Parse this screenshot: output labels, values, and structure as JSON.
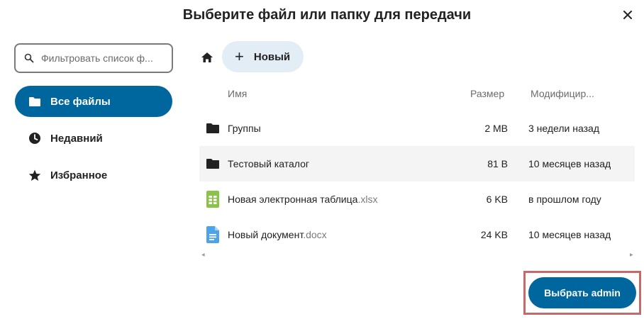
{
  "dialog": {
    "title": "Выберите файл или папку для передачи",
    "close_icon": "close-icon"
  },
  "sidebar": {
    "search_placeholder": "Фильтровать список ф...",
    "items": [
      {
        "label": "Все файлы",
        "icon": "folder-icon",
        "active": true
      },
      {
        "label": "Недавний",
        "icon": "clock-icon",
        "active": false
      },
      {
        "label": "Избранное",
        "icon": "star-icon",
        "active": false
      }
    ]
  },
  "toolbar": {
    "home_icon": "home-icon",
    "new_label": "Новый"
  },
  "table": {
    "headers": {
      "name": "Имя",
      "size": "Размер",
      "modified": "Модифицир..."
    },
    "rows": [
      {
        "name": "Группы",
        "ext": "",
        "size": "2 MB",
        "modified": "3 недели назад",
        "icon": "folder-icon"
      },
      {
        "name": "Тестовый каталог",
        "ext": "",
        "size": "81 B",
        "modified": "10 месяцев назад",
        "icon": "folder-icon"
      },
      {
        "name": "Новая электронная таблица",
        "ext": ".xlsx",
        "size": "6 KB",
        "modified": "в прошлом году",
        "icon": "spreadsheet-icon"
      },
      {
        "name": "Новый документ",
        "ext": ".docx",
        "size": "24 KB",
        "modified": "10 месяцев назад",
        "icon": "document-icon"
      }
    ]
  },
  "footer": {
    "choose_label": "Выбрать admin"
  },
  "colors": {
    "accent": "#00679e",
    "new_button_bg": "#e3edf5",
    "highlight_row": "#f4f4f4",
    "spreadsheet_green": "#8bc34a",
    "document_blue": "#4ca3e8"
  }
}
